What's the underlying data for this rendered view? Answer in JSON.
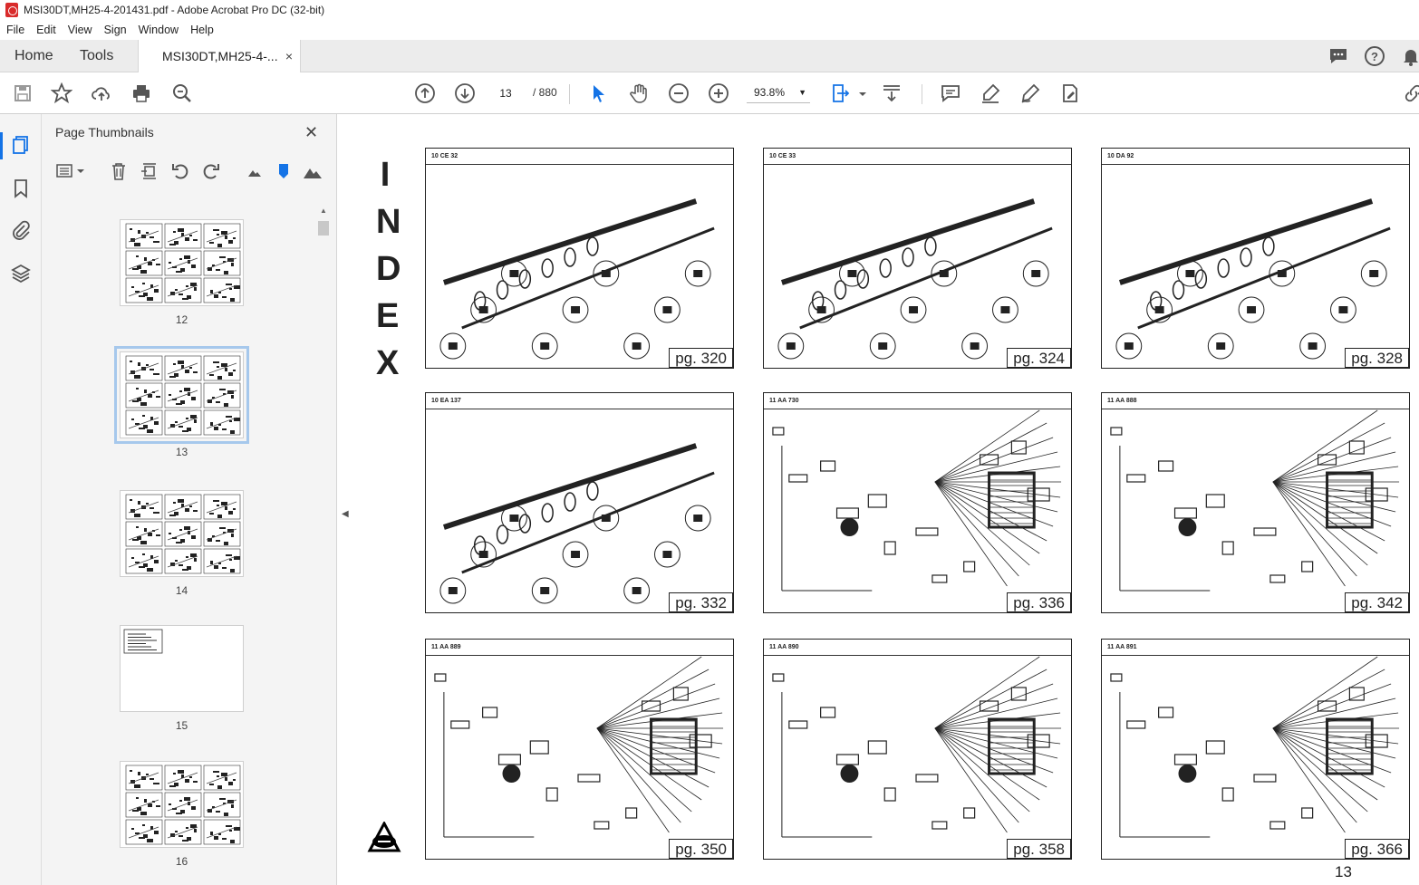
{
  "window": {
    "title": "MSI30DT,MH25-4-201431.pdf - Adobe Acrobat Pro DC (32-bit)"
  },
  "menu": [
    "File",
    "Edit",
    "View",
    "Sign",
    "Window",
    "Help"
  ],
  "tabs": {
    "home": "Home",
    "tools": "Tools",
    "document": "MSI30DT,MH25-4-...",
    "close": "×"
  },
  "toolbar": {
    "current_page": "13",
    "total_pages": "/ 880",
    "zoom": "93.8%"
  },
  "panel": {
    "title": "Page Thumbnails",
    "thumbnails": [
      {
        "label": "12",
        "selected": false
      },
      {
        "label": "13",
        "selected": true
      },
      {
        "label": "14",
        "selected": false
      },
      {
        "label": "15",
        "selected": false
      },
      {
        "label": "16",
        "selected": false
      }
    ]
  },
  "document": {
    "index_letters": [
      "I",
      "N",
      "D",
      "E",
      "X"
    ],
    "page_number": "13",
    "sheets": [
      {
        "code": "10 CE 32",
        "page": "pg. 320"
      },
      {
        "code": "10 CE 33",
        "page": "pg. 324"
      },
      {
        "code": "10 DA 92",
        "page": "pg. 328"
      },
      {
        "code": "10 EA 137",
        "page": "pg. 332"
      },
      {
        "code": "11 AA 730",
        "page": "pg. 336"
      },
      {
        "code": "11 AA 888",
        "page": "pg. 342"
      },
      {
        "code": "11 AA 889",
        "page": "pg. 350"
      },
      {
        "code": "11 AA 890",
        "page": "pg. 358"
      },
      {
        "code": "11 AA 891",
        "page": "pg. 366"
      }
    ]
  }
}
